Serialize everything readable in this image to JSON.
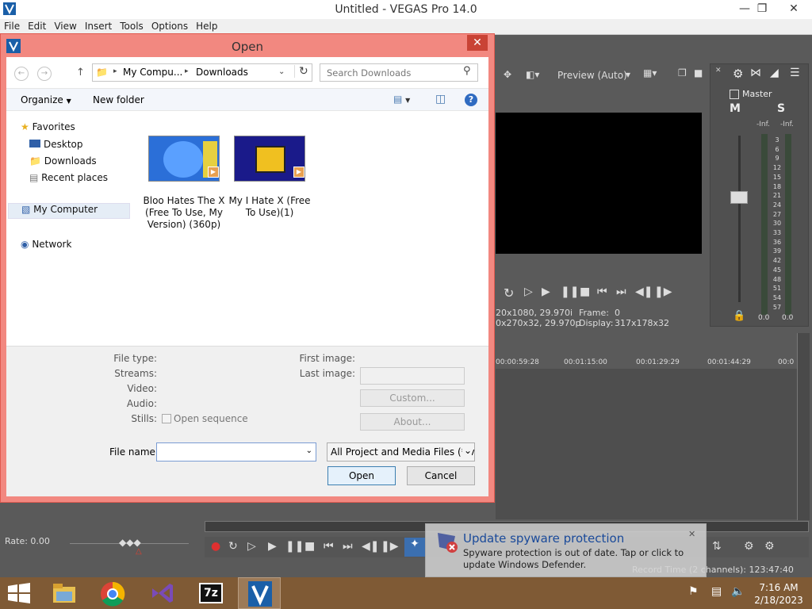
{
  "app": {
    "title": "Untitled - VEGAS Pro 14.0",
    "menu": [
      "File",
      "Edit",
      "View",
      "Insert",
      "Tools",
      "Options",
      "Help"
    ]
  },
  "preview": {
    "quality": "Preview (Auto)",
    "info": [
      "20x1080, 29.970i",
      "0x270x32, 29.970p"
    ],
    "frame_label": "Frame:",
    "frame_value": "0",
    "display_label": "Display:",
    "display_value": "317x178x32"
  },
  "mixer": {
    "master_label": "Master",
    "mute": "M",
    "solo": "S",
    "inf_left": "-Inf.",
    "inf_right": "-Inf.",
    "scale": [
      "3",
      "6",
      "9",
      "12",
      "15",
      "18",
      "21",
      "24",
      "27",
      "30",
      "33",
      "36",
      "39",
      "42",
      "45",
      "48",
      "51",
      "54",
      "57"
    ],
    "bottom_left": "0.0",
    "bottom_right": "0.0"
  },
  "timeline": {
    "ruler": [
      "00:00:59:28",
      "00:01:15:00",
      "00:01:29:29",
      "00:01:44:29",
      "00:0"
    ],
    "rate": "Rate: 0.00",
    "record_time": "Record Time (2 channels): 123:47:40"
  },
  "notification": {
    "title": "Update spyware protection",
    "body": "Spyware protection is out of date. Tap or click to update Windows Defender."
  },
  "dialog": {
    "title": "Open",
    "breadcrumb": [
      "My Compu...",
      "Downloads"
    ],
    "search_placeholder": "Search Downloads",
    "organize": "Organize",
    "new_folder": "New folder",
    "nav": {
      "favorites": "Favorites",
      "desktop": "Desktop",
      "downloads": "Downloads",
      "recent": "Recent places",
      "computer": "My Computer",
      "network": "Network"
    },
    "files": [
      {
        "name": "Bloo Hates The X (Free To Use, My Version) (360p)"
      },
      {
        "name": "My I Hate X (Free To Use)(1)"
      }
    ],
    "details": {
      "file_type": "File type:",
      "streams": "Streams:",
      "video": "Video:",
      "audio": "Audio:",
      "stills": "Stills:",
      "open_sequence": "Open sequence",
      "first_image": "First image:",
      "last_image": "Last image:",
      "custom": "Custom...",
      "about": "About..."
    },
    "filename_label": "File name:",
    "filename_value": "",
    "filter": "All Project and Media Files (*.ve",
    "open_btn": "Open",
    "cancel_btn": "Cancel"
  },
  "taskbar": {
    "time": "7:16 AM",
    "date": "2/18/2023"
  },
  "colors": {
    "dialog_frame": "#f28880",
    "close_red": "#c94335",
    "taskbar": "#7f5a35",
    "vegas_bg": "#5a5a5a"
  }
}
